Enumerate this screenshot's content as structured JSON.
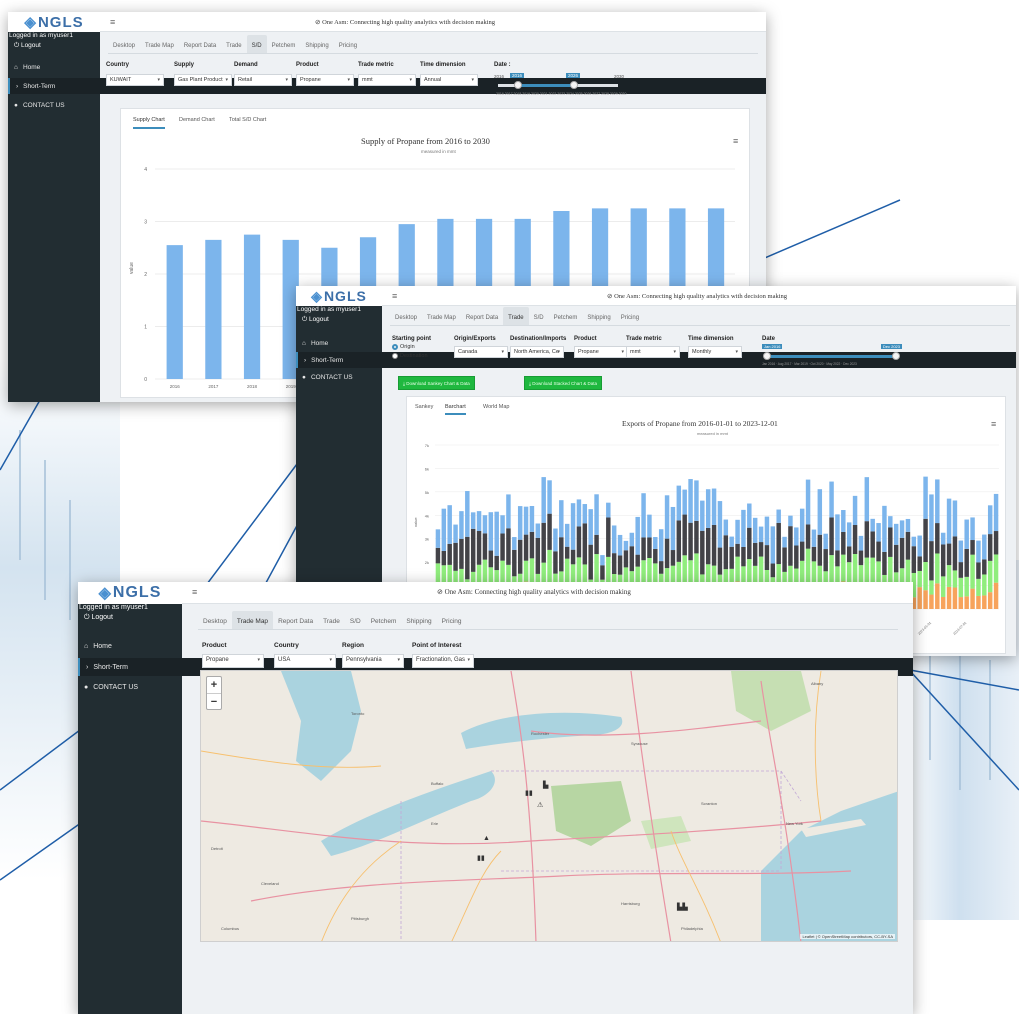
{
  "app": {
    "logo": "NGLS",
    "logged_in": "Logged in as myuser1",
    "logout": "Logout",
    "slogan": "One Asm: Connecting high quality analytics with decision making"
  },
  "nav": {
    "home": "Home",
    "short_term": "Short-Term",
    "contact": "CONTACT US"
  },
  "tabs": [
    "Desktop",
    "Trade Map",
    "Report Data",
    "Trade",
    "S/D",
    "Petchem",
    "Shipping",
    "Pricing"
  ],
  "screen1": {
    "active_tab": "S/D",
    "filters": [
      {
        "label": "Country",
        "value": "KUWAIT"
      },
      {
        "label": "Supply",
        "value": "Gas Plant Product"
      },
      {
        "label": "Demand",
        "value": "Retail"
      },
      {
        "label": "Product",
        "value": "Propane"
      },
      {
        "label": "Trade metric",
        "value": "mmt"
      },
      {
        "label": "Time dimension",
        "value": "Annual"
      }
    ],
    "date_label": "Date :",
    "slider_bounds": [
      "2016",
      "2030"
    ],
    "slider_values": [
      "2016",
      "2026"
    ],
    "subtabs": [
      "Supply Chart",
      "Demand Chart",
      "Total S/D Chart"
    ],
    "active_subtab": "Supply Chart",
    "chart_title": "Supply of Propane from 2016 to 2030",
    "chart_subtitle": "measured in mmt",
    "ylabel": "value"
  },
  "chart_data": [
    {
      "type": "bar",
      "title": "Supply of Propane from 2016 to 2030",
      "subtitle": "measured in mmt",
      "ylabel": "value",
      "ylim": [
        0,
        4
      ],
      "yticks": [
        "0",
        "1",
        "2",
        "3",
        "4"
      ],
      "categories": [
        "2016",
        "2017",
        "2018",
        "2019",
        "2020",
        "2021",
        "2022",
        "2023",
        "2024",
        "2025",
        "2026",
        "2027",
        "2028",
        "2029",
        "2030"
      ],
      "values": [
        2.55,
        2.65,
        2.75,
        2.65,
        2.5,
        2.7,
        2.95,
        3.05,
        3.05,
        3.05,
        3.2,
        3.25,
        3.25,
        3.25,
        3.25
      ],
      "color": "#7cb5ec"
    },
    {
      "type": "bar",
      "stacked": true,
      "title": "Exports of Propane from 2016-01-01 to 2023-12-01",
      "subtitle": "measured in mmt",
      "ylabel": "value",
      "yticks": [
        "0",
        "1k",
        "2k",
        "3k",
        "4k",
        "5k",
        "6k",
        "7k"
      ],
      "ylim": [
        0,
        7000
      ],
      "periods": 96,
      "series": [
        {
          "color": "#f7a35c",
          "values": []
        },
        {
          "color": "#90ed7d",
          "values": []
        },
        {
          "color": "#434348",
          "values": []
        },
        {
          "color": "#7cb5ec",
          "values": []
        }
      ]
    }
  ],
  "screen2": {
    "active_tab": "Trade",
    "starting_point_label": "Starting point",
    "radio_origin": "Origin",
    "radio_destination": "Destination",
    "filters": [
      {
        "label": "Origin/Exports",
        "value": "Canada"
      },
      {
        "label": "Destination/Imports",
        "value": "North America, Ce"
      },
      {
        "label": "Product",
        "value": "Propane"
      },
      {
        "label": "Trade metric",
        "value": "mmt"
      },
      {
        "label": "Time dimension",
        "value": "Monthly"
      }
    ],
    "date_label": "Date",
    "slider_values": [
      "Jan 2016",
      "Dec 2023"
    ],
    "download_buttons": [
      "Download Sankey Chart & Data",
      "Download Stacked Chart & Data"
    ],
    "subtabs": [
      "Sankey",
      "Barchart",
      "World Map"
    ],
    "active_subtab": "Barchart",
    "chart_title": "Exports of Propane from 2016-01-01 to 2023-12-01",
    "chart_subtitle": "measured in mmt"
  },
  "screen3": {
    "active_tab": "Trade Map",
    "filters": [
      {
        "label": "Product",
        "value": "Propane"
      },
      {
        "label": "Country",
        "value": "USA"
      },
      {
        "label": "Region",
        "value": "Pennsylvania"
      },
      {
        "label": "Point of Interest",
        "value": "Fractionation, Gas"
      }
    ],
    "zoom_in": "+",
    "zoom_out": "−",
    "attribution": "Leaflet | © OpenStreetMap contributors, CC-BY-SA",
    "cities": [
      "Toronto",
      "Buffalo",
      "Rochester",
      "Syracuse",
      "Detroit",
      "Cleveland",
      "Pittsburgh",
      "Harrisburg",
      "Philadelphia",
      "New York",
      "Columbus",
      "Albany",
      "Scranton",
      "Erie"
    ]
  }
}
